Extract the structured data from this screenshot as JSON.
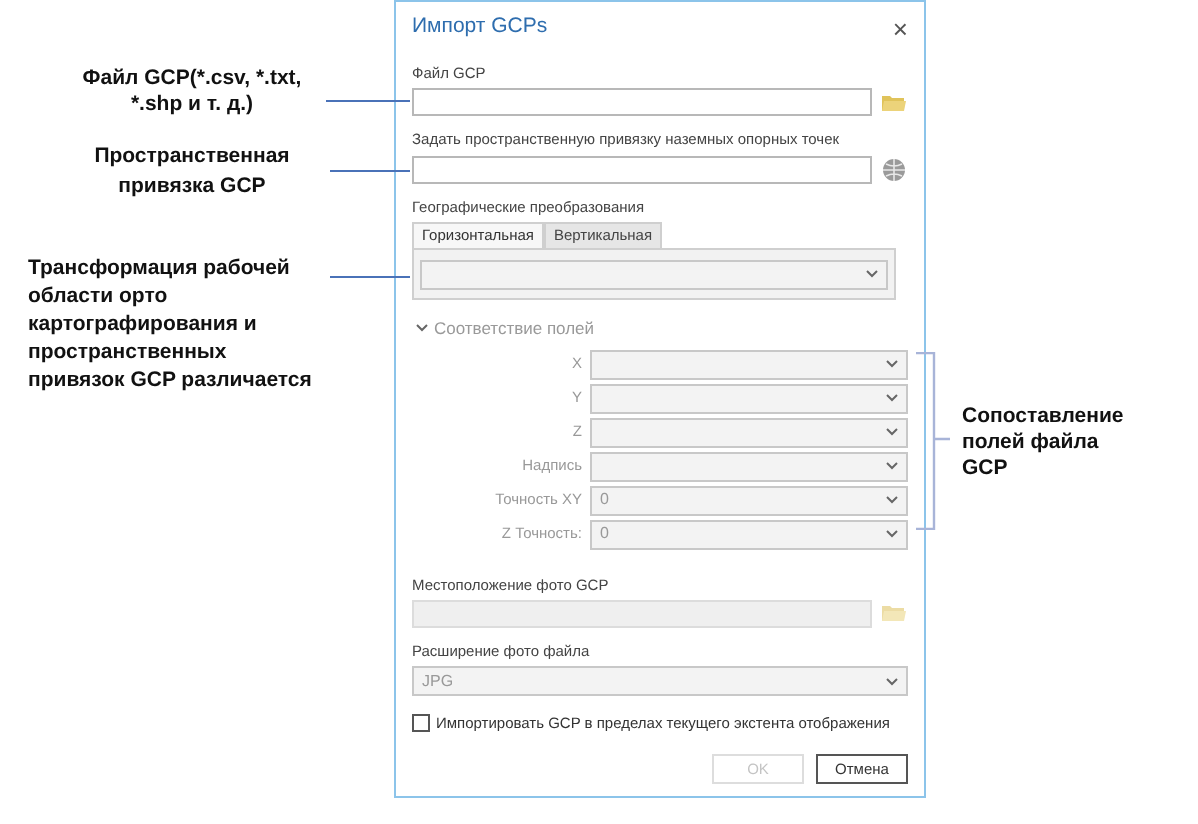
{
  "annotations": [
    {
      "text": "Файл GCP(*.csv, *.txt, *.shp и т. д.)"
    },
    {
      "text": "Пространственная привязка GCP"
    },
    {
      "text": "Трансформация рабочей области орто картографирования и пространственных привязок GCP различается"
    }
  ],
  "dialog": {
    "title": "Импорт GCPs",
    "close": "×",
    "gcp_file": {
      "label": "Файл GCP"
    },
    "spatial_reference": {
      "label": "Задать пространственную привязку наземных опорных точек"
    },
    "geo_transforms": {
      "label": "Географические преобразования",
      "tabs": [
        {
          "label": "Горизонтальная",
          "selected": true
        },
        {
          "label": "Вертикальная",
          "selected": false
        }
      ]
    },
    "field_mapping": {
      "title": "Соответствие полей",
      "expanded": true,
      "rows": [
        {
          "label": "X"
        },
        {
          "label": "Y"
        },
        {
          "label": "Z"
        },
        {
          "label": "Надпись"
        },
        {
          "label": "Точность XY",
          "value": "0"
        },
        {
          "label": "Z Точность:",
          "value": "0"
        }
      ]
    },
    "photo_location": {
      "label": "Местоположение фото GCP",
      "disabled": true
    },
    "photo_extension": {
      "label": "Расширение фото файла",
      "value": "JPG"
    },
    "checkbox": {
      "label": "Импортировать GCP в пределах текущего экстента отображения",
      "checked": false
    },
    "buttons": [
      {
        "label": "OK",
        "disabled": true
      },
      {
        "label": "Отмена",
        "disabled": false
      }
    ]
  },
  "side_note": {
    "text": "Сопоставление полей файла GCP"
  }
}
